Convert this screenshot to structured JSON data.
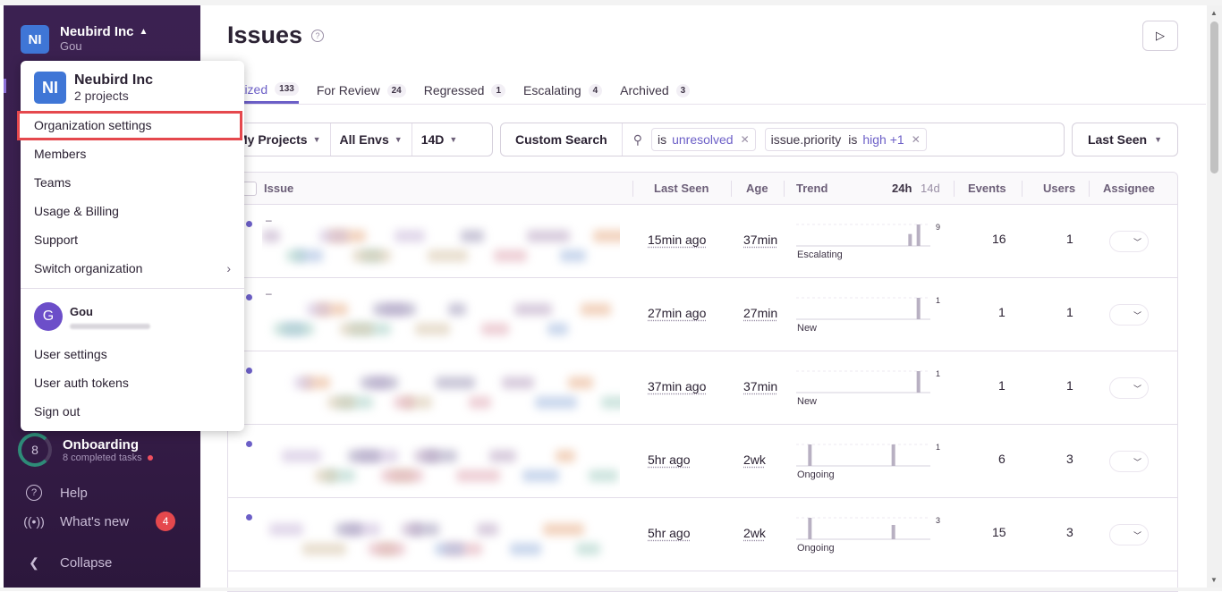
{
  "org": {
    "initials": "NI",
    "name": "Neubird Inc",
    "user": "Gou",
    "projects": "2 projects"
  },
  "menu": {
    "items": [
      "Organization settings",
      "Members",
      "Teams",
      "Usage & Billing",
      "Support",
      "Switch organization"
    ],
    "user_initial": "G",
    "user_name": "Gou",
    "user_items": [
      "User settings",
      "User auth tokens",
      "Sign out"
    ]
  },
  "sidebar": {
    "onboarding": {
      "count": "8",
      "title": "Onboarding",
      "subtitle": "8 completed tasks"
    },
    "help": "Help",
    "whats_new": "What's new",
    "whats_new_badge": "4",
    "collapse": "Collapse"
  },
  "page": {
    "title": "Issues"
  },
  "tabs": [
    {
      "label": "oritized",
      "count": "133"
    },
    {
      "label": "For Review",
      "count": "24"
    },
    {
      "label": "Regressed",
      "count": "1"
    },
    {
      "label": "Escalating",
      "count": "4"
    },
    {
      "label": "Archived",
      "count": "3"
    }
  ],
  "filters": {
    "projects": "My Projects",
    "envs": "All Envs",
    "period": "14D"
  },
  "search": {
    "custom": "Custom Search",
    "token1_key": "is",
    "token1_value": "unresolved",
    "token2_key": "issue.priority",
    "token2_op": "is",
    "token2_value": "high +1"
  },
  "sort": "Last Seen",
  "columns": {
    "issue": "Issue",
    "last_seen": "Last Seen",
    "age": "Age",
    "trend": "Trend",
    "trend_24h": "24h",
    "trend_14d": "14d",
    "events": "Events",
    "users": "Users",
    "assignee": "Assignee"
  },
  "rows": [
    {
      "last_seen": "15min ago",
      "age": "37min",
      "trend_label": "Escalating",
      "trend_max": "9",
      "events": "16",
      "users": "1",
      "spark": [
        0,
        0,
        0,
        0,
        0,
        0,
        0,
        0,
        0,
        0,
        0,
        0,
        0,
        5,
        9
      ]
    },
    {
      "last_seen": "27min ago",
      "age": "27min",
      "trend_label": "New",
      "trend_max": "1",
      "events": "1",
      "users": "1",
      "spark": [
        0,
        0,
        0,
        0,
        0,
        0,
        0,
        0,
        0,
        0,
        0,
        0,
        0,
        0,
        1
      ]
    },
    {
      "last_seen": "37min ago",
      "age": "37min",
      "trend_label": "New",
      "trend_max": "1",
      "events": "1",
      "users": "1",
      "spark": [
        0,
        0,
        0,
        0,
        0,
        0,
        0,
        0,
        0,
        0,
        0,
        0,
        0,
        0,
        1
      ]
    },
    {
      "last_seen": "5hr ago",
      "age": "2wk",
      "trend_label": "Ongoing",
      "trend_max": "1",
      "events": "6",
      "users": "3",
      "spark": [
        0,
        1,
        0,
        0,
        0,
        0,
        0,
        0,
        0,
        0,
        0,
        1,
        0,
        0,
        0
      ]
    },
    {
      "last_seen": "5hr ago",
      "age": "2wk",
      "trend_label": "Ongoing",
      "trend_max": "3",
      "events": "15",
      "users": "3",
      "spark": [
        0,
        3,
        0,
        0,
        0,
        0,
        0,
        0,
        0,
        0,
        0,
        2,
        0,
        0,
        0
      ]
    }
  ],
  "colors": {
    "sidebar": "#3b2151",
    "accent": "#6c5fc7",
    "highlight": "#e5484d"
  }
}
